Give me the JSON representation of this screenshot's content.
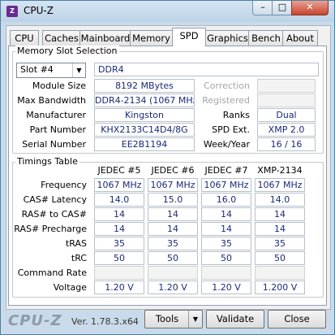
{
  "window": {
    "title": "CPU-Z",
    "minimize": "–",
    "maximize": "□",
    "close": "✕",
    "icon": "cpuz-app-icon"
  },
  "tabs": [
    "CPU",
    "Caches",
    "Mainboard",
    "Memory",
    "SPD",
    "Graphics",
    "Bench",
    "About"
  ],
  "active_tab": "SPD",
  "memory_slot": {
    "legend": "Memory Slot Selection",
    "slot": "Slot #4",
    "type": "DDR4",
    "labels": {
      "module_size": "Module Size",
      "max_bandwidth": "Max Bandwidth",
      "manufacturer": "Manufacturer",
      "part_number": "Part Number",
      "serial_number": "Serial Number",
      "correction": "Correction",
      "registered": "Registered",
      "ranks": "Ranks",
      "spd_ext": "SPD Ext.",
      "week_year": "Week/Year"
    },
    "values": {
      "module_size": "8192 MBytes",
      "max_bandwidth": "DDR4-2134 (1067 MHz)",
      "manufacturer": "Kingston",
      "part_number": "KHX2133C14D4/8G",
      "serial_number": "EE2B1194",
      "correction": "",
      "registered": "",
      "ranks": "Dual",
      "spd_ext": "XMP 2.0",
      "week_year": "16 / 16"
    }
  },
  "timings": {
    "legend": "Timings Table",
    "columns": [
      "JEDEC #5",
      "JEDEC #6",
      "JEDEC #7",
      "XMP-2134"
    ],
    "rows": [
      {
        "label": "Frequency",
        "values": [
          "1067 MHz",
          "1067 MHz",
          "1067 MHz",
          "1067 MHz"
        ]
      },
      {
        "label": "CAS# Latency",
        "values": [
          "14.0",
          "15.0",
          "16.0",
          "14.0"
        ]
      },
      {
        "label": "RAS# to CAS#",
        "values": [
          "14",
          "14",
          "14",
          "14"
        ]
      },
      {
        "label": "RAS# Precharge",
        "values": [
          "14",
          "14",
          "14",
          "14"
        ]
      },
      {
        "label": "tRAS",
        "values": [
          "35",
          "35",
          "35",
          "35"
        ]
      },
      {
        "label": "tRC",
        "values": [
          "50",
          "50",
          "50",
          "50"
        ]
      },
      {
        "label": "Command Rate",
        "values": [
          "",
          "",
          "",
          ""
        ]
      },
      {
        "label": "Voltage",
        "values": [
          "1.20 V",
          "1.20 V",
          "1.20 V",
          "1.200 V"
        ]
      }
    ]
  },
  "footer": {
    "brand": "CPU-Z",
    "version": "Ver. 1.78.3.x64",
    "tools": "Tools",
    "validate": "Validate",
    "close": "Close"
  }
}
